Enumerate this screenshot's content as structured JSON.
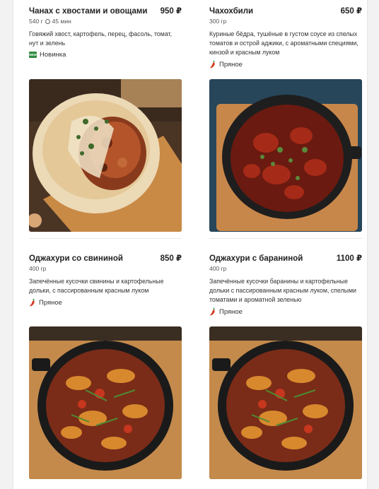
{
  "items": [
    {
      "title": "Чанах с хвостами и овощами",
      "price": "950 ₽",
      "weight": "540 г",
      "time": "45 мин",
      "description": "Говяжий хвост, картофель, перец, фасоль, томат, нут и зелень",
      "tag": "Новинка",
      "tag_icon": "new-badge-icon"
    },
    {
      "title": "Чахохбили",
      "price": "650 ₽",
      "weight": "300 гр",
      "description": "Куриные бёдра, тушёные в густом соусе из спелых томатов и острой аджики, с ароматными специями, кинзой и красным луком",
      "tag": "Пряное",
      "tag_icon": "chili-pepper-icon"
    },
    {
      "title": "Оджахури со свининой",
      "price": "850 ₽",
      "weight": "400 гр",
      "description": "Запечённые кусочки свинины и картофельные дольки, с пассированным красным луком",
      "tag": "Пряное",
      "tag_icon": "chili-pepper-icon"
    },
    {
      "title": "Оджахури с бараниной",
      "price": "1100 ₽",
      "weight": "400 гр",
      "description": "Запечённые кусочки баранины и картофельные дольки с пассированным красным луком, спелыми томатами и ароматной зеленью",
      "tag": "Пряное",
      "tag_icon": "chili-pepper-icon"
    }
  ],
  "new_badge_text": "NEW",
  "colors": {
    "background": "#ffffff",
    "page": "#f2f2f2",
    "text": "#222222",
    "new_badge": "#2e8b3e",
    "chili": "#d23a1e"
  }
}
